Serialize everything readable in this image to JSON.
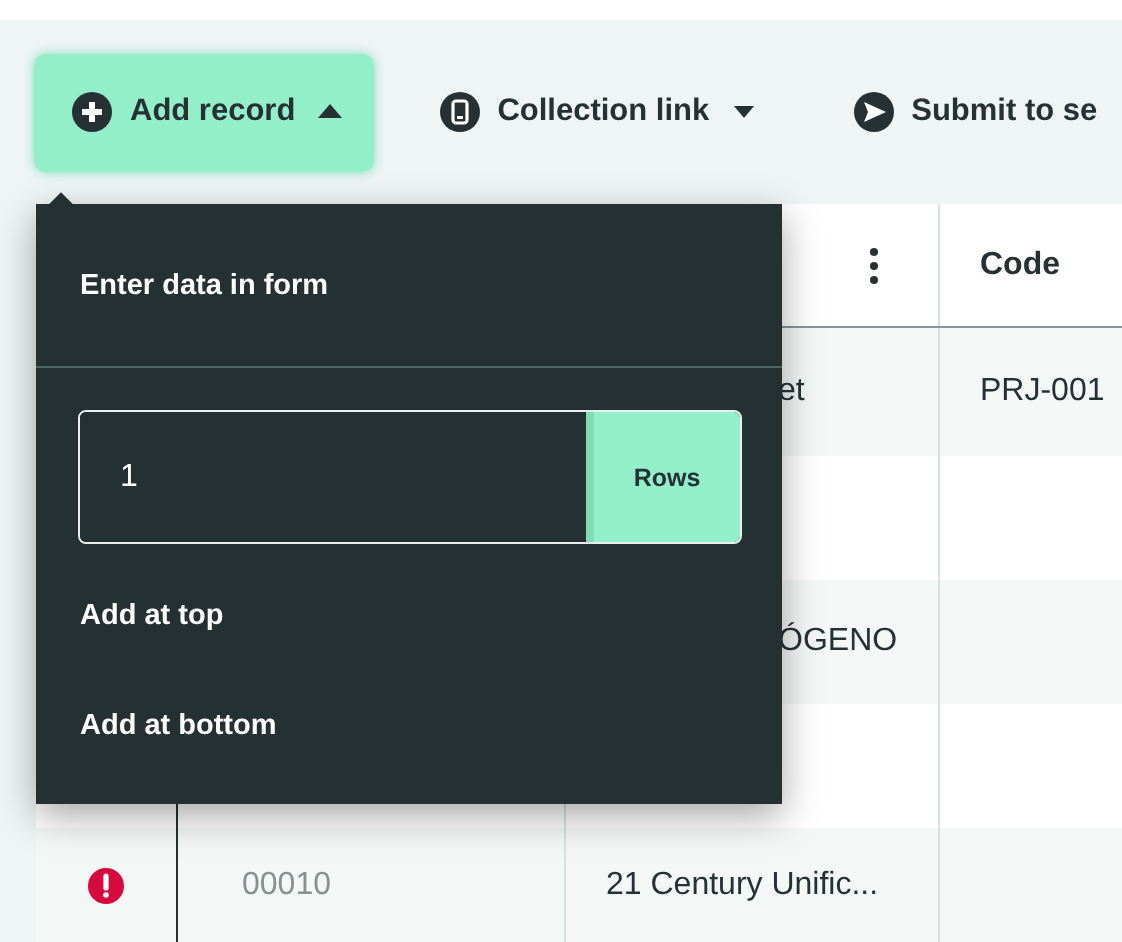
{
  "toolbar": {
    "buttons": [
      {
        "kind": "add",
        "label": "Add record",
        "expanded": true,
        "selected": true
      },
      {
        "kind": "link",
        "label": "Collection link",
        "expanded": false,
        "selected": false
      },
      {
        "kind": "submit",
        "label": "Submit to se",
        "selected": false
      }
    ]
  },
  "menu": {
    "title": "Enter data in form",
    "rows_field": {
      "value": "1",
      "unit": "Rows"
    },
    "items": [
      "Add at top",
      "Add at bottom"
    ]
  },
  "table": {
    "header": {
      "code": "Code"
    },
    "rows": [
      {
        "column_3": "et",
        "code": "PRJ-001"
      },
      {},
      {
        "column_3": "ÓGENO"
      },
      {},
      {
        "error": true,
        "id": "00010",
        "column_3": "21 Century Unific..."
      }
    ]
  }
}
